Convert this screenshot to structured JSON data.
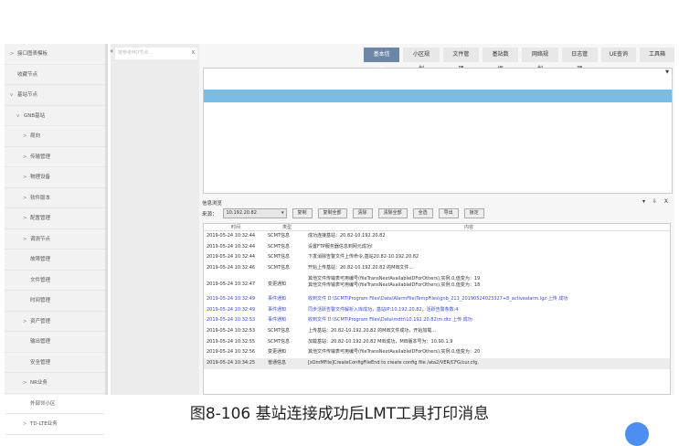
{
  "tree": [
    {
      "label": "接口图表模板",
      "chev": ">",
      "indent": 0
    },
    {
      "label": "收藏节点",
      "chev": "",
      "indent": 0
    },
    {
      "label": "基站节点",
      "chev": "v",
      "indent": 0
    },
    {
      "label": "GNB基站",
      "chev": "v",
      "indent": 1
    },
    {
      "label": "局向",
      "chev": ">",
      "indent": 2
    },
    {
      "label": "传输管理",
      "chev": ">",
      "indent": 2
    },
    {
      "label": "物理设备",
      "chev": ">",
      "indent": 2
    },
    {
      "label": "软件版本",
      "chev": ">",
      "indent": 2
    },
    {
      "label": "配置管理",
      "chev": ">",
      "indent": 2
    },
    {
      "label": "调测节点",
      "chev": ">",
      "indent": 2
    },
    {
      "label": "故障管理",
      "chev": "",
      "indent": 2
    },
    {
      "label": "文件管理",
      "chev": "",
      "indent": 2
    },
    {
      "label": "时间管理",
      "chev": "",
      "indent": 2
    },
    {
      "label": "资产管理",
      "chev": ">",
      "indent": 2
    },
    {
      "label": "输出管理",
      "chev": "",
      "indent": 2
    },
    {
      "label": "安全管理",
      "chev": "",
      "indent": 2
    },
    {
      "label": "NR业务",
      "chev": ">",
      "indent": 2
    },
    {
      "label": "外部邻小区",
      "chev": "",
      "indent": 2
    },
    {
      "label": "TD-LTE业务",
      "chev": ">",
      "indent": 2
    }
  ],
  "search": {
    "placeholder": "按参考MO节点...",
    "clear": "X"
  },
  "tabs": [
    "基本信息",
    "小区规划",
    "文件管理",
    "基站数据",
    "网络规划",
    "日志管理",
    "UE查询",
    "工具箱"
  ],
  "info": {
    "title": "信息浏览",
    "window_controls": "▾ ⇩ X",
    "source_label": "来源：",
    "source_value": "10.192.20.82",
    "buttons": [
      "复制",
      "复制全部",
      "清除",
      "清除全部",
      "全选",
      "导出",
      "锁定"
    ],
    "columns": [
      "时间",
      "类型",
      "内容",
      ""
    ],
    "rows": [
      {
        "time": "2019-05-24 10:32:44",
        "type": "SCMT信息",
        "content": "成功连接基站：20.82-10.192.20.82",
        "style": ""
      },
      {
        "time": "2019-05-24 10:32:44",
        "type": "SCMT信息",
        "content": "设置FTP服务器信息到网元成功!",
        "style": ""
      },
      {
        "time": "2019-05-24 10:32:44",
        "type": "SCMT信息",
        "content": "下发消除告警文件上传命令,基站20.82-10.192.20.82",
        "style": ""
      },
      {
        "time": "2019-05-24 10:32:46",
        "type": "SCMT信息",
        "content": "开始上传基站：20.82-10.192.20.82 的MIB文件...",
        "style": ""
      },
      {
        "time": "2019-05-24 10:32:47",
        "type": "变更通知",
        "content": "其他文件传输表可用编号(fileTransNextAvailableIDForOthers),实例.0,值变为：19",
        "content2": "其他文件传输表可用编号(fileTransNextAvailableIDForOthers),实例.0,值变为：18",
        "style": "two"
      },
      {
        "time": "2019-05-24 10:32:49",
        "type": "事件通知",
        "content": "收到文件 D:\\SCMT\\Program Files\\Data\\AlarmFile\\TempFiles\\gnb_211_20190524023327+8_activealarm.lgz 上传 成功",
        "style": "blue"
      },
      {
        "time": "2019-05-24 10:32:49",
        "type": "事件通知",
        "content": "同步活跃告警文件解析入库成功，基站IP:10.192.20.82，活跃告警条数:4",
        "style": "blue"
      },
      {
        "time": "2019-05-24 10:32:53",
        "type": "事件通知",
        "content": "收到文件 D:\\SCMT\\Program Files\\Data\\mdtr\\10.192.20.82\\m.dtz 上传 成功",
        "style": "blue"
      },
      {
        "time": "2019-05-24 10:32:53",
        "type": "SCMT信息",
        "content": "上传基站：20.82-10.192.20.82 的MIB文件成功，开始加载...",
        "style": ""
      },
      {
        "time": "2019-05-24 10:32:55",
        "type": "SCMT信息",
        "content": "加载基站：20.82-10.192.20.82 MIB成功，MIB版本号为：10.90.1.9",
        "style": ""
      },
      {
        "time": "2019-05-24 10:32:56",
        "type": "变更通知",
        "content": "其他文件传输表可用编号(fileTransNextAvailableIDForOthers),实例.0,值变为：20",
        "style": ""
      },
      {
        "time": "2019-05-24 10:34:25",
        "type": "普通信息",
        "content": "[sOmMFile]CreateConfigFileEnd to create config file /ata2/VER/CFG/cur.cfg.",
        "style": "hl"
      }
    ]
  },
  "caption": "图8-106   基站连接成功后LMT工具打印消息",
  "colors": {
    "active_tab": "#6d86a6",
    "selection": "#79bde6",
    "event_text": "#3a49d6"
  }
}
